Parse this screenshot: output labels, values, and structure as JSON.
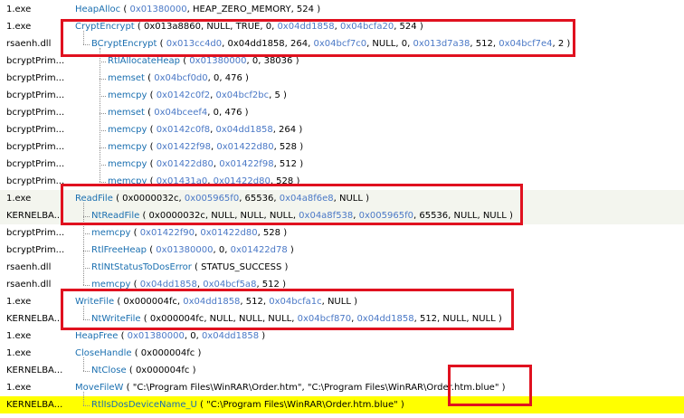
{
  "rows": [
    {
      "module": "1.exe",
      "fn": "HeapAlloc",
      "args": [
        [
          "a",
          "0x01380000"
        ],
        [
          "s",
          "HEAP_ZERO_MEMORY"
        ],
        [
          "s",
          "524"
        ]
      ]
    },
    {
      "module": "1.exe",
      "fn": "CryptEncrypt",
      "args": [
        [
          "s",
          "0x013a8860"
        ],
        [
          "s",
          "NULL"
        ],
        [
          "s",
          "TRUE"
        ],
        [
          "s",
          "0"
        ],
        [
          "a",
          "0x04dd1858"
        ],
        [
          "a",
          "0x04bcfa20"
        ],
        [
          "s",
          "524"
        ]
      ]
    },
    {
      "module": "rsaenh.dll",
      "fn": "BCryptEncrypt",
      "args": [
        [
          "a",
          "0x013cc4d0"
        ],
        [
          "s",
          "0x04dd1858"
        ],
        [
          "s",
          "264"
        ],
        [
          "a",
          "0x04bcf7c0"
        ],
        [
          "s",
          "NULL"
        ],
        [
          "s",
          "0"
        ],
        [
          "a",
          "0x013d7a38"
        ],
        [
          "s",
          "512"
        ],
        [
          "a",
          "0x04bcf7e4"
        ],
        [
          "s",
          "2"
        ]
      ]
    },
    {
      "module": "bcryptPrim...",
      "fn": "RtlAllocateHeap",
      "args": [
        [
          "a",
          "0x01380000"
        ],
        [
          "s",
          "0"
        ],
        [
          "s",
          "38036"
        ]
      ]
    },
    {
      "module": "bcryptPrim...",
      "fn": "memset",
      "args": [
        [
          "a",
          "0x04bcf0d0"
        ],
        [
          "s",
          "0"
        ],
        [
          "s",
          "476"
        ]
      ]
    },
    {
      "module": "bcryptPrim...",
      "fn": "memcpy",
      "args": [
        [
          "a",
          "0x0142c0f2"
        ],
        [
          "a",
          "0x04bcf2bc"
        ],
        [
          "s",
          "5"
        ]
      ]
    },
    {
      "module": "bcryptPrim...",
      "fn": "memset",
      "args": [
        [
          "a",
          "0x04bceef4"
        ],
        [
          "s",
          "0"
        ],
        [
          "s",
          "476"
        ]
      ]
    },
    {
      "module": "bcryptPrim...",
      "fn": "memcpy",
      "args": [
        [
          "a",
          "0x0142c0f8"
        ],
        [
          "a",
          "0x04dd1858"
        ],
        [
          "s",
          "264"
        ]
      ]
    },
    {
      "module": "bcryptPrim...",
      "fn": "memcpy",
      "args": [
        [
          "a",
          "0x01422f98"
        ],
        [
          "a",
          "0x01422d80"
        ],
        [
          "s",
          "528"
        ]
      ]
    },
    {
      "module": "bcryptPrim...",
      "fn": "memcpy",
      "args": [
        [
          "a",
          "0x01422d80"
        ],
        [
          "a",
          "0x01422f98"
        ],
        [
          "s",
          "512"
        ]
      ]
    },
    {
      "module": "bcryptPrim...",
      "fn": "memcpy",
      "args": [
        [
          "a",
          "0x01431a0"
        ],
        [
          "a",
          "0x01422d80"
        ],
        [
          "s",
          "528"
        ]
      ]
    },
    {
      "module": "1.exe",
      "fn": "ReadFile",
      "args": [
        [
          "s",
          "0x0000032c"
        ],
        [
          "a",
          "0x005965f0"
        ],
        [
          "s",
          "65536"
        ],
        [
          "a",
          "0x04a8f6e8"
        ],
        [
          "s",
          "NULL"
        ]
      ]
    },
    {
      "module": "KERNELBA...",
      "fn": "NtReadFile",
      "args": [
        [
          "s",
          "0x0000032c"
        ],
        [
          "s",
          "NULL"
        ],
        [
          "s",
          "NULL"
        ],
        [
          "s",
          "NULL"
        ],
        [
          "a",
          "0x04a8f538"
        ],
        [
          "a",
          "0x005965f0"
        ],
        [
          "s",
          "65536"
        ],
        [
          "s",
          "NULL"
        ],
        [
          "s",
          "NULL"
        ]
      ]
    },
    {
      "module": "bcryptPrim...",
      "fn": "memcpy",
      "args": [
        [
          "a",
          "0x01422f90"
        ],
        [
          "a",
          "0x01422d80"
        ],
        [
          "s",
          "528"
        ]
      ]
    },
    {
      "module": "bcryptPrim...",
      "fn": "RtlFreeHeap",
      "args": [
        [
          "a",
          "0x01380000"
        ],
        [
          "s",
          "0"
        ],
        [
          "a",
          "0x01422d78"
        ]
      ]
    },
    {
      "module": "rsaenh.dll",
      "fn": "RtlNtStatusToDosError",
      "args": [
        [
          "s",
          "STATUS_SUCCESS"
        ]
      ]
    },
    {
      "module": "rsaenh.dll",
      "fn": "memcpy",
      "args": [
        [
          "a",
          "0x04dd1858"
        ],
        [
          "a",
          "0x04bcf5a8"
        ],
        [
          "s",
          "512"
        ]
      ]
    },
    {
      "module": "1.exe",
      "fn": "WriteFile",
      "args": [
        [
          "s",
          "0x000004fc"
        ],
        [
          "a",
          "0x04dd1858"
        ],
        [
          "s",
          "512"
        ],
        [
          "a",
          "0x04bcfa1c"
        ],
        [
          "s",
          "NULL"
        ]
      ]
    },
    {
      "module": "KERNELBA...",
      "fn": "NtWriteFile",
      "args": [
        [
          "s",
          "0x000004fc"
        ],
        [
          "s",
          "NULL"
        ],
        [
          "s",
          "NULL"
        ],
        [
          "s",
          "NULL"
        ],
        [
          "a",
          "0x04bcf870"
        ],
        [
          "a",
          "0x04dd1858"
        ],
        [
          "s",
          "512"
        ],
        [
          "s",
          "NULL"
        ],
        [
          "s",
          "NULL"
        ]
      ]
    },
    {
      "module": "1.exe",
      "fn": "HeapFree",
      "args": [
        [
          "a",
          "0x01380000"
        ],
        [
          "s",
          "0"
        ],
        [
          "a",
          "0x04dd1858"
        ]
      ]
    },
    {
      "module": "1.exe",
      "fn": "CloseHandle",
      "args": [
        [
          "s",
          "0x000004fc"
        ]
      ]
    },
    {
      "module": "KERNELBA...",
      "fn": "NtClose",
      "args": [
        [
          "s",
          "0x000004fc"
        ]
      ]
    },
    {
      "module": "1.exe",
      "fn": "MoveFileW",
      "args": [
        [
          "s",
          "\"C:\\Program Files\\WinRAR\\Order.htm\""
        ],
        [
          "s",
          "\"C:\\Program Files\\WinRAR\\Order.htm.blue\""
        ]
      ]
    },
    {
      "module": "KERNELBA...",
      "fn": "RtlIsDosDeviceName_U",
      "args": [
        [
          "s",
          "\"C:\\Program Files\\WinRAR\\Order.htm.blue\""
        ]
      ]
    }
  ],
  "colors": {
    "function": "#1a6fb0",
    "address": "#4a78c6",
    "highlight_row": "#ffff00",
    "annotation_box": "#e0111f"
  }
}
